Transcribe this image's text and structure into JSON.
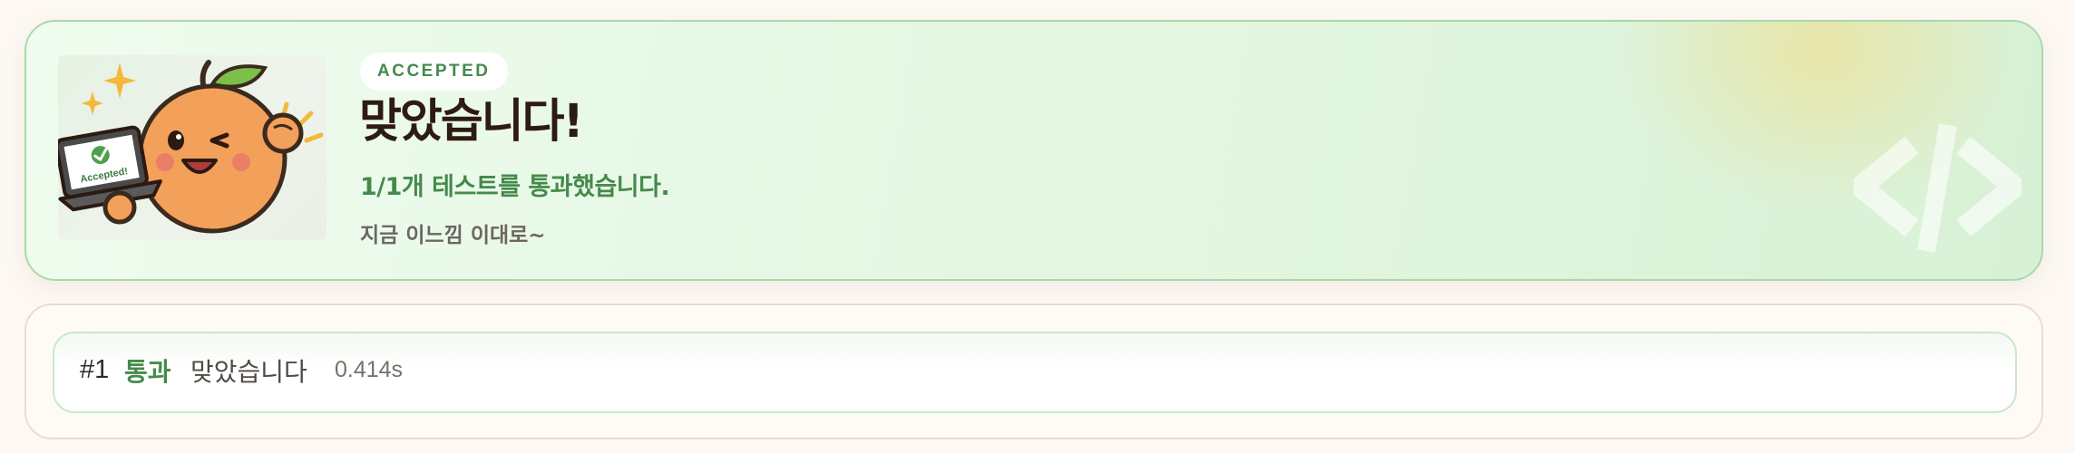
{
  "result": {
    "badge": "ACCEPTED",
    "title": "맞았습니다!",
    "summary": "1/1개 테스트를 통과했습니다.",
    "message": "지금 이느낌 이대로~",
    "mascot_screen_text": "Accepted!",
    "mascot_icon": "orange-mascot-icon",
    "decor_icon": "code-brackets-icon",
    "accent_color": "#458a4c"
  },
  "tests": [
    {
      "number": "#1",
      "status": "통과",
      "message": "맞았습니다",
      "time": "0.414s"
    }
  ]
}
